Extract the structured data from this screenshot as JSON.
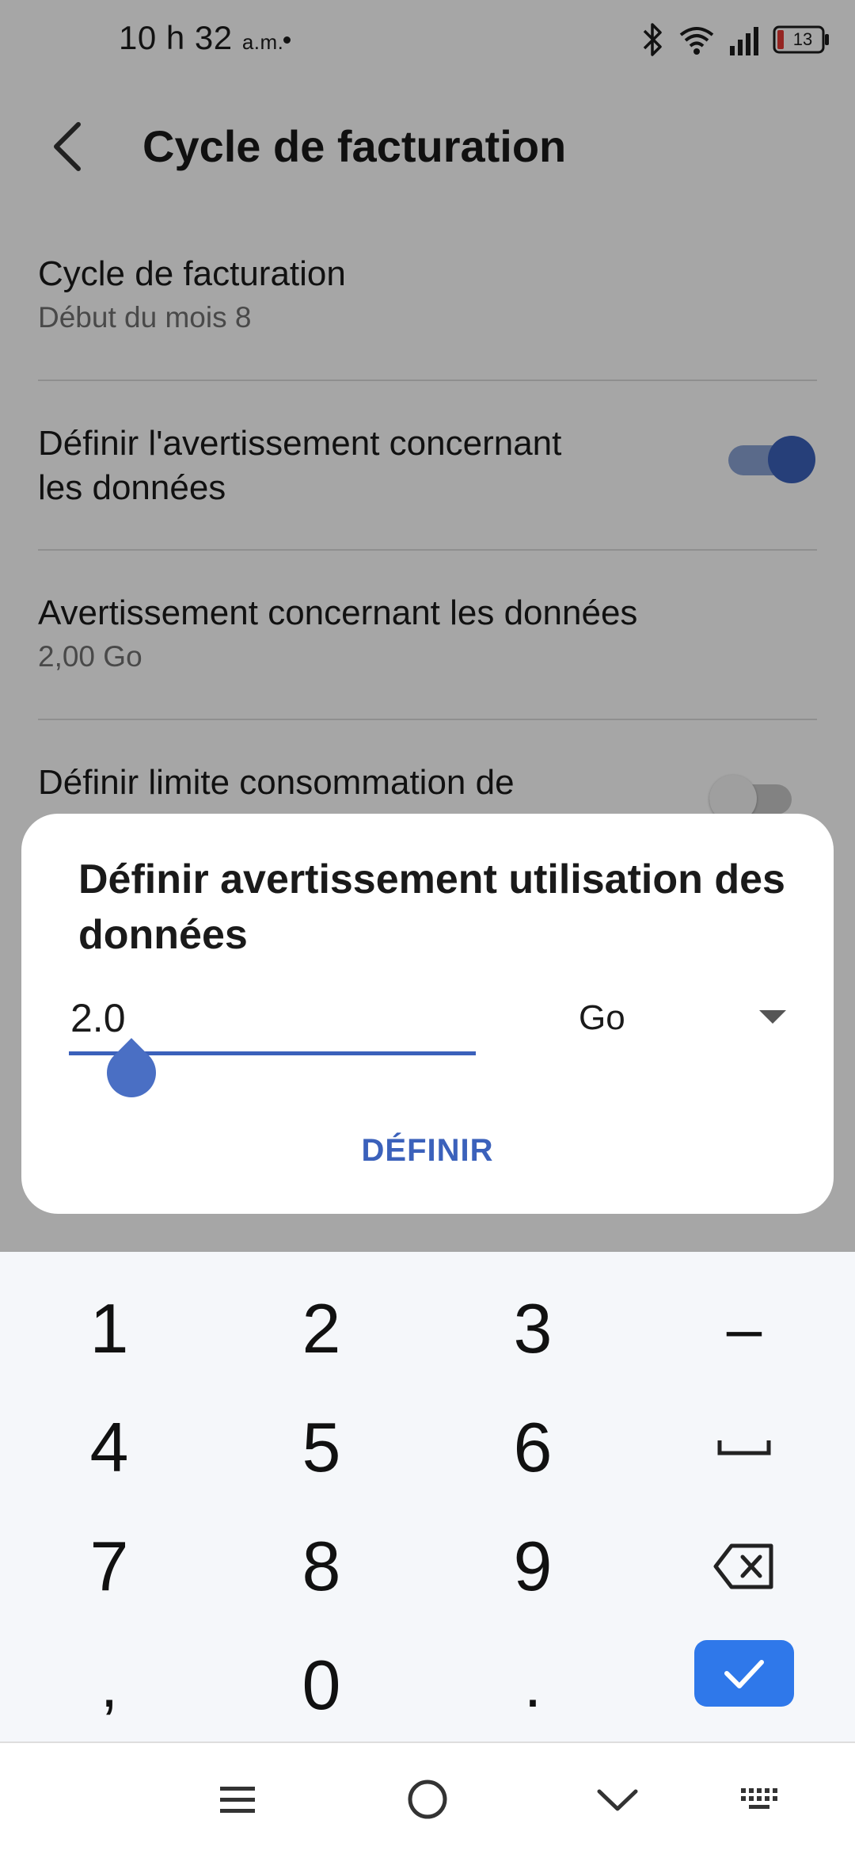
{
  "status_bar": {
    "time": "10 h 32",
    "ampm": "a.m.",
    "battery_level": "13"
  },
  "app_bar": {
    "title": "Cycle de facturation"
  },
  "settings": [
    {
      "title": "Cycle de facturation",
      "subtitle": "Début du mois 8"
    },
    {
      "title_line1": "Définir l'avertissement concernant",
      "title_line2": "les données",
      "toggle_on": true
    },
    {
      "title": "Avertissement concernant les données",
      "subtitle": "2,00 Go"
    },
    {
      "title": "Définir limite consommation de",
      "toggle_on": false
    }
  ],
  "dialog": {
    "title": "Définir avertissement utilisation des données",
    "value": "2.0",
    "unit": "Go",
    "confirm_label": "DÉFINIR"
  },
  "keyboard": {
    "keys": [
      "1",
      "2",
      "3",
      "–",
      "4",
      "5",
      "6",
      "7",
      "8",
      "9",
      ",",
      "0",
      "."
    ],
    "icons": [
      "space-icon",
      "backspace-icon",
      "checkmark-icon"
    ]
  },
  "nav_bar": {
    "icons": [
      "menu-icon",
      "home-circle-icon",
      "chevron-down-icon",
      "keyboard-icon"
    ]
  },
  "colors": {
    "accent": "#3b61bb",
    "confirm_key": "#2f78ea",
    "keyboard_bg": "#f5f7fa",
    "battery_low": "#e53935"
  }
}
